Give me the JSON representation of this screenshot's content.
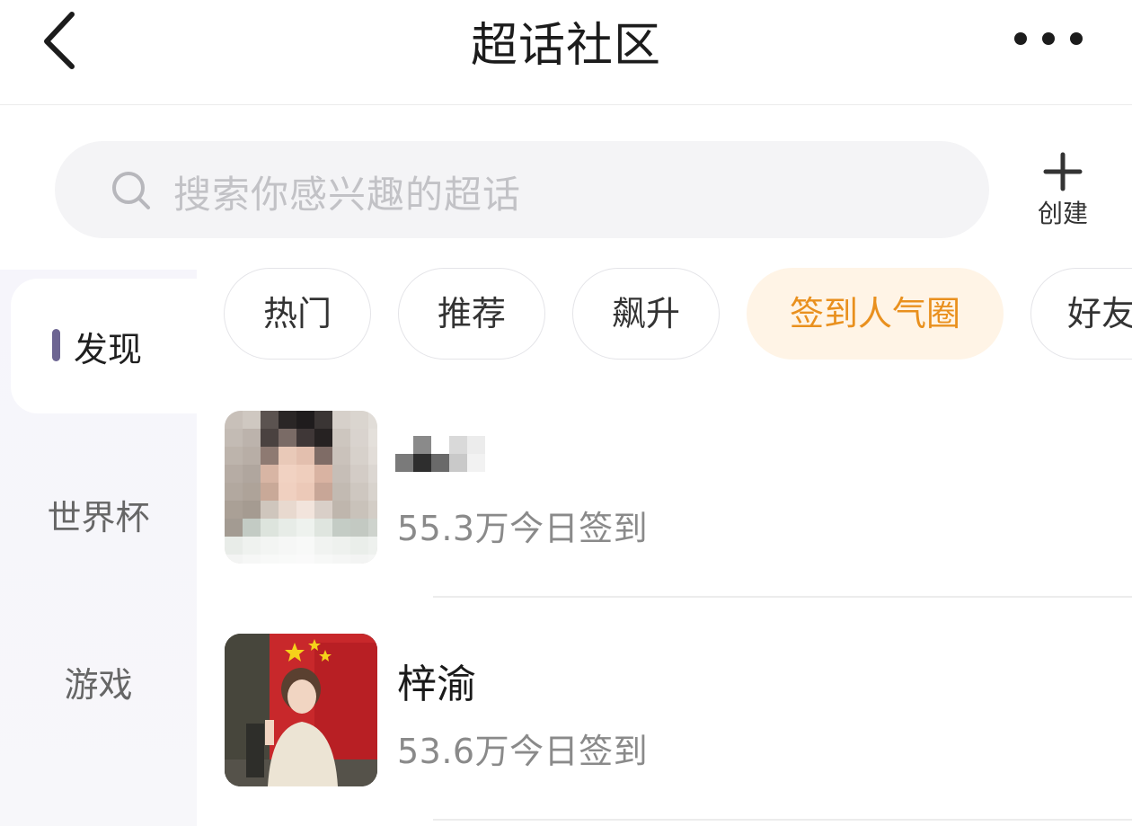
{
  "header": {
    "title": "超话社区",
    "back_icon": "chevron-left-icon",
    "more_icon": "more-dots-icon"
  },
  "search": {
    "placeholder": "搜索你感兴趣的超话",
    "create_label": "创建"
  },
  "sidebar": {
    "items": [
      {
        "label": "发现",
        "active": true
      },
      {
        "label": "世界杯",
        "active": false
      },
      {
        "label": "游戏",
        "active": false
      }
    ]
  },
  "tabs": [
    {
      "label": "热门",
      "active": false
    },
    {
      "label": "推荐",
      "active": false
    },
    {
      "label": "飙升",
      "active": false
    },
    {
      "label": "签到人气圈",
      "active": true
    },
    {
      "label": "好友",
      "active": false
    }
  ],
  "list": [
    {
      "name": "",
      "signin_text": "55.3万今日签到"
    },
    {
      "name": "梓渝",
      "signin_text": "53.6万今日签到"
    }
  ],
  "colors": {
    "accent": "#e9901e",
    "accent_bg": "#fff4e6",
    "sidebar_bar": "#6d6592"
  }
}
